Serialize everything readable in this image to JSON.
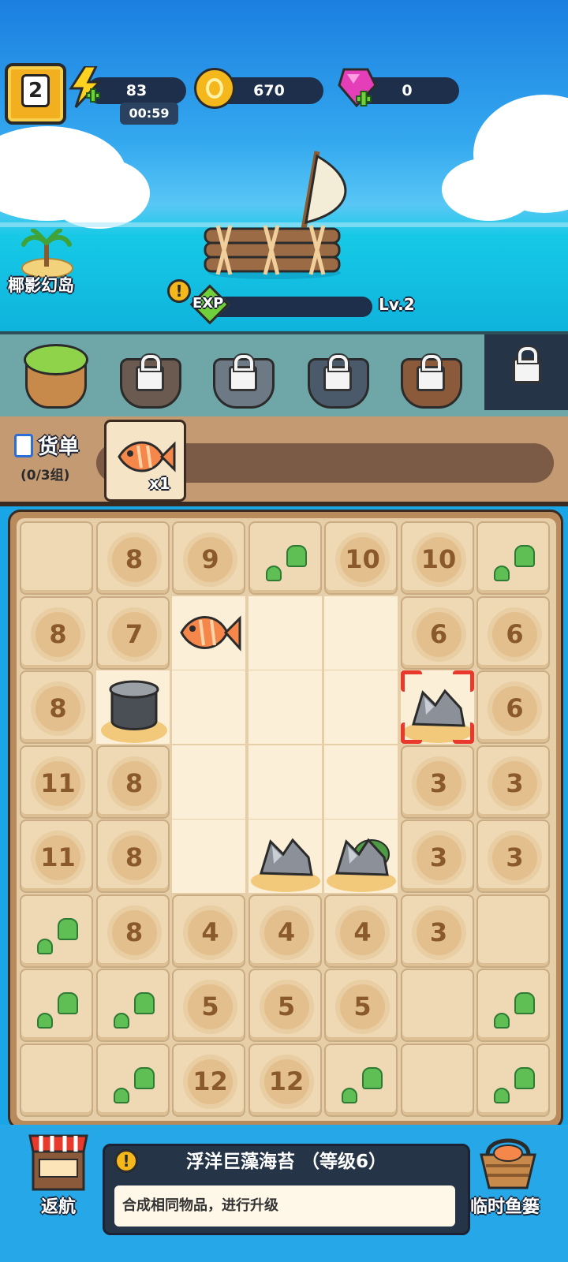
{
  "hud": {
    "player_level": "2",
    "energy": "83",
    "energy_timer": "00:59",
    "coins": "670",
    "gems": "0"
  },
  "island": {
    "name": "椰影幻岛"
  },
  "raft": {
    "exp_label": "EXP",
    "level_label": "Lv.2",
    "exp_progress": 0.0
  },
  "shelf": {
    "slots": [
      {
        "name": "green-pot",
        "locked": false
      },
      {
        "name": "brown-bucket",
        "locked": true
      },
      {
        "name": "brown-bucket-2",
        "locked": true
      },
      {
        "name": "stone-pot",
        "locked": true
      },
      {
        "name": "coral-pot",
        "locked": true
      },
      {
        "name": "extra-slot",
        "locked": true
      }
    ]
  },
  "orders": {
    "title": "货单",
    "progress": "(0/3组)",
    "items": [
      {
        "icon": "fish-icon",
        "count": "x1"
      }
    ]
  },
  "board": {
    "cells": [
      [
        "",
        "8",
        "9",
        "plant",
        "10",
        "10",
        "plant"
      ],
      [
        "8",
        "7",
        "fish",
        "open",
        "open",
        "6",
        "6"
      ],
      [
        "8",
        "pot",
        "open",
        "open",
        "open",
        "rock-selected",
        "6"
      ],
      [
        "11",
        "8",
        "open",
        "open",
        "open",
        "3",
        "3"
      ],
      [
        "11",
        "8",
        "open",
        "rock",
        "rock-moss",
        "3",
        "3"
      ],
      [
        "plant",
        "8",
        "4",
        "4",
        "4",
        "3",
        ""
      ],
      [
        "plant",
        "plant",
        "5",
        "5",
        "5",
        "",
        "plant"
      ],
      [
        "",
        "plant",
        "12",
        "12",
        "plant",
        "",
        "plant"
      ]
    ]
  },
  "bottom": {
    "return_label": "返航",
    "basket_label": "临时鱼篓",
    "item_title": "浮洋巨藻海苔 （等级6）",
    "item_desc": "合成相同物品，进行升级"
  },
  "colors": {
    "hud_pill": "#1d2f4a",
    "coin": "#f5b81c",
    "gem": "#e43fb8",
    "board_bg": "#e6cfa8",
    "selection": "#e8392c"
  }
}
